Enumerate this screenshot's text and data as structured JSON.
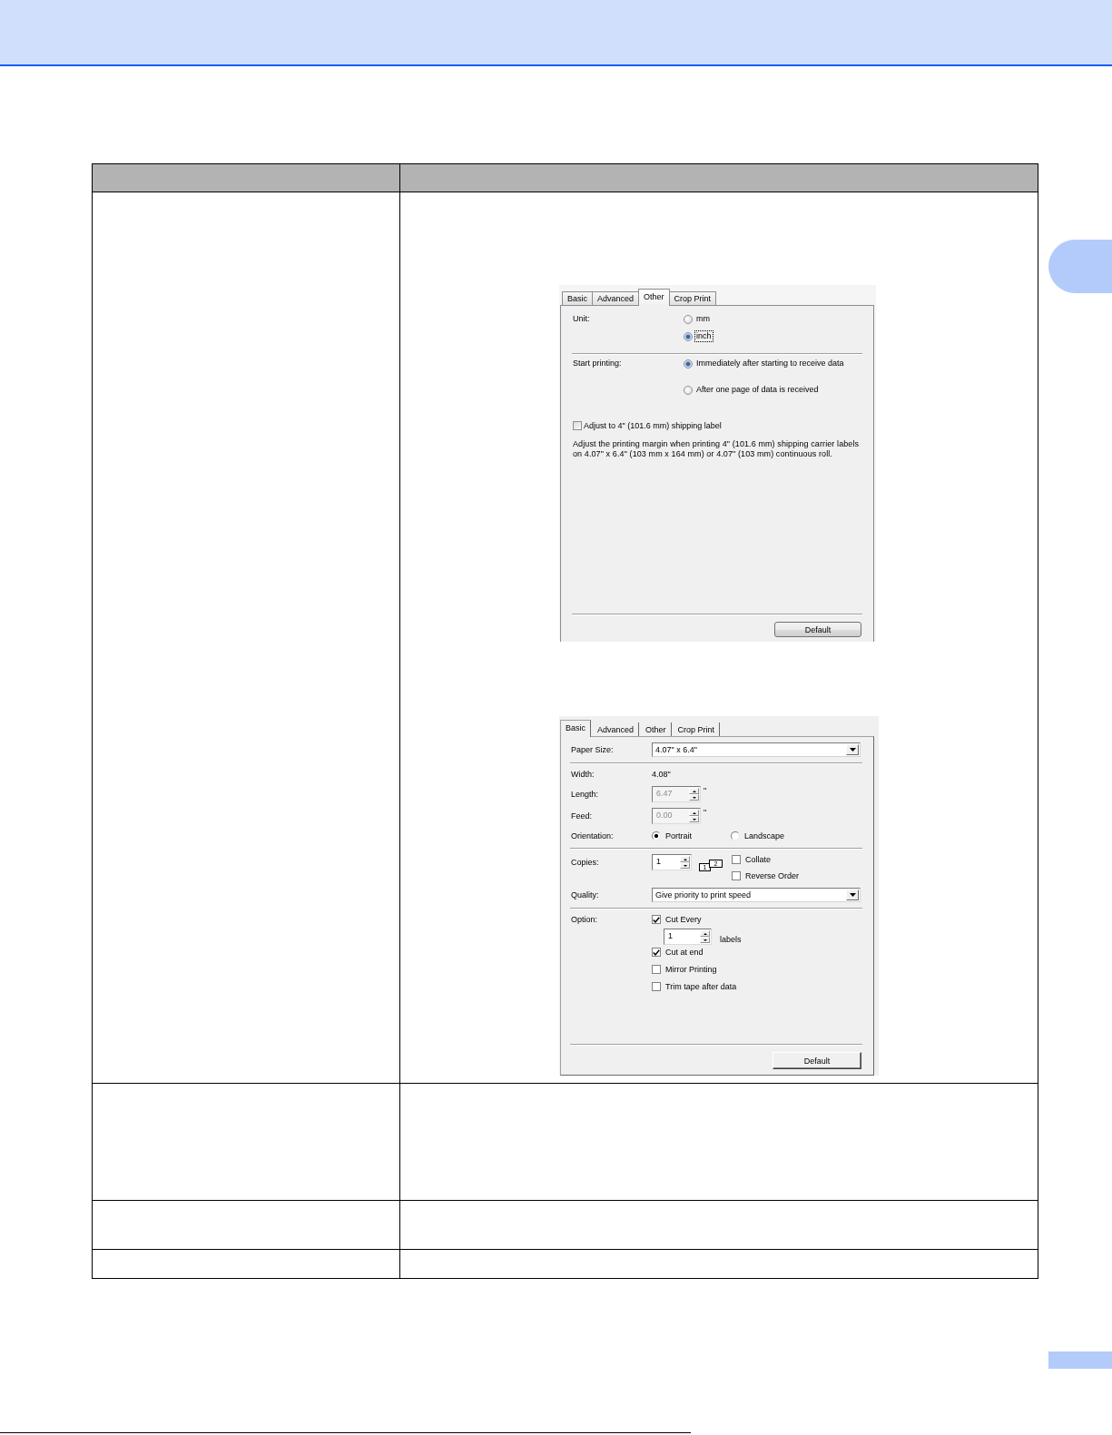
{
  "dialogs": [
    {
      "kind": "aero",
      "tabs": [
        {
          "label": "Basic",
          "selected": false
        },
        {
          "label": "Advanced",
          "selected": false
        },
        {
          "label": "Other",
          "selected": true
        },
        {
          "label": "Crop Print",
          "selected": false
        }
      ],
      "sections": [
        [
          {
            "kind": "radio_group",
            "label": "Unit:",
            "options": [
              {
                "label": "mm",
                "selected": false,
                "focused": false
              },
              {
                "label": "inch",
                "selected": true,
                "focused": true
              }
            ]
          }
        ],
        [
          {
            "kind": "radio_group",
            "label": "Start printing:",
            "options": [
              {
                "label": "Immediately after starting to receive data",
                "selected": true,
                "focused": false
              },
              {
                "label": "After one page of data is received",
                "selected": false,
                "focused": false
              }
            ]
          },
          {
            "kind": "checkbox",
            "label": "Adjust to 4\" (101.6 mm) shipping label",
            "checked": false
          },
          {
            "kind": "note",
            "text": "Adjust the printing margin when printing 4\" (101.6 mm) shipping carrier labels on 4.07\" x 6.4\" (103 mm x 164 mm) or 4.07\" (103 mm) continuous roll."
          }
        ]
      ],
      "button": "Default"
    },
    {
      "kind": "classic",
      "tabs": [
        {
          "label": "Basic",
          "selected": true
        },
        {
          "label": "Advanced",
          "selected": false
        },
        {
          "label": "Other",
          "selected": false
        },
        {
          "label": "Crop Print",
          "selected": false
        }
      ],
      "sections": [
        [
          {
            "kind": "dropdown",
            "label": "Paper Size:",
            "value": "4.07\" x 6.4\""
          }
        ],
        [
          {
            "kind": "value",
            "label": "Width:",
            "value": "4.08\""
          },
          {
            "kind": "spinbox",
            "label": "Length:",
            "value": "6.47",
            "unit": "\"",
            "disabled": true
          },
          {
            "kind": "spinbox",
            "label": "Feed:",
            "value": "0.00",
            "unit": "\"",
            "disabled": true
          },
          {
            "kind": "radio_row",
            "label": "Orientation:",
            "options": [
              {
                "label": "Portrait",
                "selected": true
              },
              {
                "label": "Landscape",
                "selected": false
              }
            ]
          }
        ],
        [
          {
            "kind": "copies",
            "label": "Copies:",
            "value": "1",
            "pages": [
              "1",
              "2"
            ],
            "options": [
              {
                "label": "Collate",
                "checked": false
              },
              {
                "label": "Reverse Order",
                "checked": false
              }
            ]
          },
          {
            "kind": "dropdown",
            "label": "Quality:",
            "value": "Give priority to print speed"
          }
        ],
        [
          {
            "kind": "checklist",
            "label": "Option:",
            "options": [
              {
                "label": "Cut Every",
                "checked": true,
                "count": {
                  "value": "1",
                  "unit": "labels"
                }
              },
              {
                "label": "Cut at end",
                "checked": true
              },
              {
                "label": "Mirror Printing",
                "checked": false
              },
              {
                "label": "Trim tape after data",
                "checked": false
              }
            ]
          }
        ]
      ],
      "button": "Default"
    }
  ]
}
